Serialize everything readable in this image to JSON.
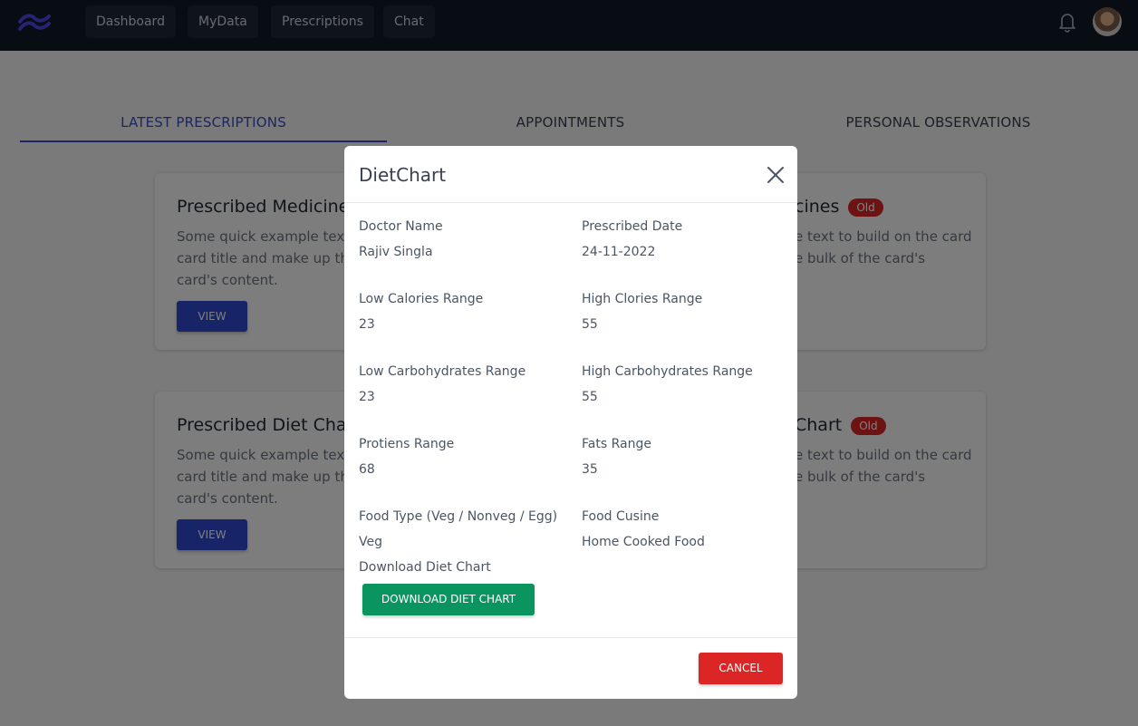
{
  "nav": {
    "items": [
      "Dashboard",
      "MyData",
      "Prescriptions",
      "Chat"
    ],
    "logo_icon": "wave-logo-icon",
    "bell_icon": "bell-icon",
    "accent": "#6366f1"
  },
  "tabs": [
    {
      "label": "LATEST PRESCRIPTIONS",
      "active": true
    },
    {
      "label": "APPOINTMENTS",
      "active": false
    },
    {
      "label": "PERSONAL OBSERVATIONS",
      "active": false
    }
  ],
  "cards": [
    {
      "title": "Prescribed Medicine",
      "text": "Some quick example text to build on the card title and make up the bulk of the card's content.",
      "button": "VIEW",
      "right_title": "cines",
      "right_text": "e text to build on the card e bulk of the card's",
      "badge": "Old"
    },
    {
      "title": "Prescribed Diet Cha",
      "text": "Some quick example text to build on the card title and make up the bulk of the card's content.",
      "button": "VIEW",
      "right_title": "Chart",
      "right_text": "e text to build on the card e bulk of the card's",
      "badge": "Old"
    }
  ],
  "modal": {
    "title": "DietChart",
    "fields": [
      {
        "label": "Doctor Name",
        "value": "Rajiv Singla"
      },
      {
        "label": "Prescribed Date",
        "value": "24-11-2022"
      },
      {
        "label": "Low Calories Range",
        "value": "23"
      },
      {
        "label": "High Clories Range",
        "value": "55"
      },
      {
        "label": "Low Carbohydrates Range",
        "value": "23"
      },
      {
        "label": "High Carbohydrates Range",
        "value": "55"
      },
      {
        "label": "Protiens Range",
        "value": "68"
      },
      {
        "label": "Fats Range",
        "value": "35"
      },
      {
        "label": "Food Type (Veg / Nonveg / Egg)",
        "value": "Veg"
      },
      {
        "label": "Food Cusine",
        "value": "Home Cooked Food"
      }
    ],
    "download_label": "Download Diet Chart",
    "download_button": "DOWNLOAD DIET CHART",
    "cancel_button": "CANCEL",
    "colors": {
      "download": "#0a9460",
      "cancel": "#dc2626",
      "view": "#2f49d1"
    }
  }
}
